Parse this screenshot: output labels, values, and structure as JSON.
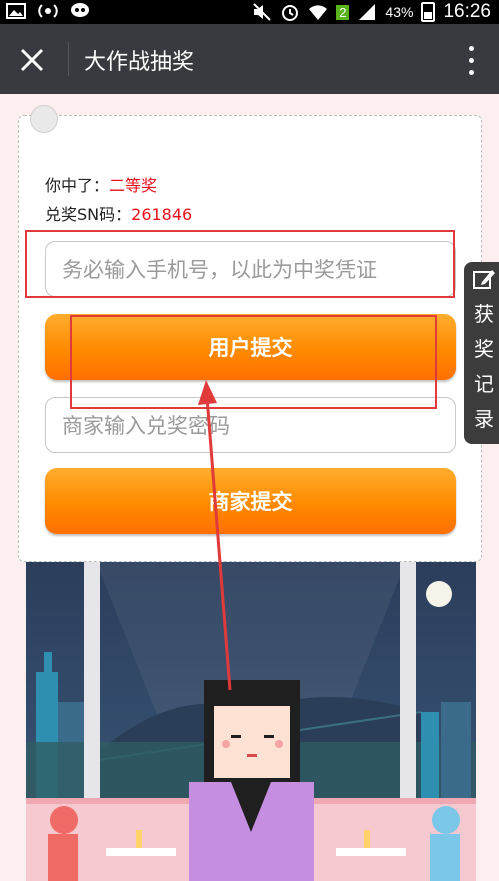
{
  "status_bar": {
    "battery_pct": "43%",
    "badge": "2",
    "time": "16:26"
  },
  "titlebar": {
    "title": "大作战抽奖"
  },
  "result": {
    "prize_label": "你中了：",
    "prize_value": "二等奖",
    "sn_label": "兑奖SN码：",
    "sn_value": "261846"
  },
  "form": {
    "phone_placeholder": "务必输入手机号，以此为中奖凭证",
    "user_submit": "用户提交",
    "password_placeholder": "商家输入兑奖密码",
    "merchant_submit": "商家提交"
  },
  "side_tab": {
    "chars": [
      "获",
      "奖",
      "记",
      "录"
    ]
  },
  "colors": {
    "accent_orange": "#ff8a00",
    "highlight_red": "#e8101c",
    "titlebar": "#393a3f"
  }
}
